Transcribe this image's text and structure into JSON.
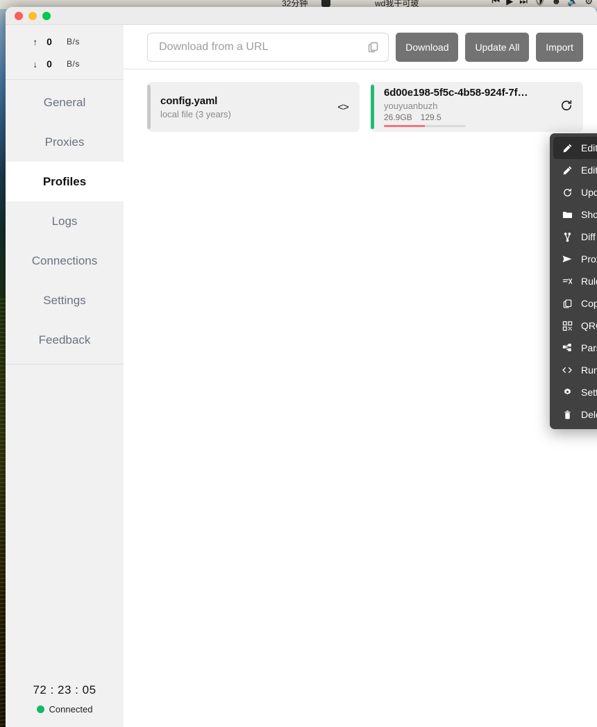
{
  "menubar": {
    "left_text": "32分钟",
    "mid_text": "wd我干可玻",
    "right_icons": [
      "prev-track-icon",
      "play-icon",
      "next-track-icon",
      "shield-icon",
      "smiley-icon",
      "volume-icon",
      "control-center-icon"
    ]
  },
  "window": {
    "traffic_lights": [
      "close",
      "minimize",
      "maximize"
    ]
  },
  "sidebar": {
    "speed": {
      "upload": {
        "arrow": "↑",
        "value": "0",
        "unit": "B/s"
      },
      "download": {
        "arrow": "↓",
        "value": "0",
        "unit": "B/s"
      }
    },
    "items": [
      {
        "label": "General",
        "active": false
      },
      {
        "label": "Proxies",
        "active": false
      },
      {
        "label": "Profiles",
        "active": true
      },
      {
        "label": "Logs",
        "active": false
      },
      {
        "label": "Connections",
        "active": false
      },
      {
        "label": "Settings",
        "active": false
      },
      {
        "label": "Feedback",
        "active": false
      }
    ],
    "status": {
      "timer": "72 : 23 : 05",
      "connection_label": "Connected",
      "connection_color": "#14b866"
    }
  },
  "toolbar": {
    "url_value": "",
    "url_placeholder": "Download from a URL",
    "paste_icon": "copy-icon",
    "download_label": "Download",
    "update_all_label": "Update All",
    "import_label": "Import",
    "button_color": "#737373"
  },
  "profiles": [
    {
      "title": "config.yaml",
      "subtitle": "local file (3 years)",
      "accent_color": "#c9c9c9",
      "action_icon": "code-icon",
      "stats": null,
      "progress_percent": null
    },
    {
      "title": "6d00e198-5f5c-4b58-924f-7f…",
      "subtitle": "youyuanbuzh",
      "accent_color": "#21ba72",
      "action_icon": "refresh-icon",
      "stats": [
        "26.9GB",
        "129.5"
      ],
      "progress_percent": 50,
      "progress_color": "#f4737f"
    }
  ],
  "context_menu": {
    "items": [
      {
        "label": "Edit",
        "icon": "pencil-icon",
        "selected": true
      },
      {
        "label": "Edit externally",
        "icon": "pencil-icon",
        "selected": false
      },
      {
        "label": "Update",
        "icon": "refresh-icon",
        "selected": false
      },
      {
        "label": "Show in folder",
        "icon": "folder-icon",
        "selected": false
      },
      {
        "label": "Diff",
        "icon": "diff-branch-icon",
        "selected": false
      },
      {
        "label": "Proxies",
        "icon": "send-icon",
        "selected": false
      },
      {
        "label": "Rules",
        "icon": "filter-icon",
        "selected": false
      },
      {
        "label": "Copy",
        "icon": "copy-icon",
        "selected": false
      },
      {
        "label": "QRCode",
        "icon": "qrcode-icon",
        "selected": false
      },
      {
        "label": "Parsers",
        "icon": "nodes-icon",
        "selected": false
      },
      {
        "label": "Run script",
        "icon": "code-icon",
        "selected": false
      },
      {
        "label": "Settings",
        "icon": "gear-icon",
        "selected": false
      },
      {
        "label": "Delete",
        "icon": "trash-icon",
        "selected": false
      }
    ]
  }
}
